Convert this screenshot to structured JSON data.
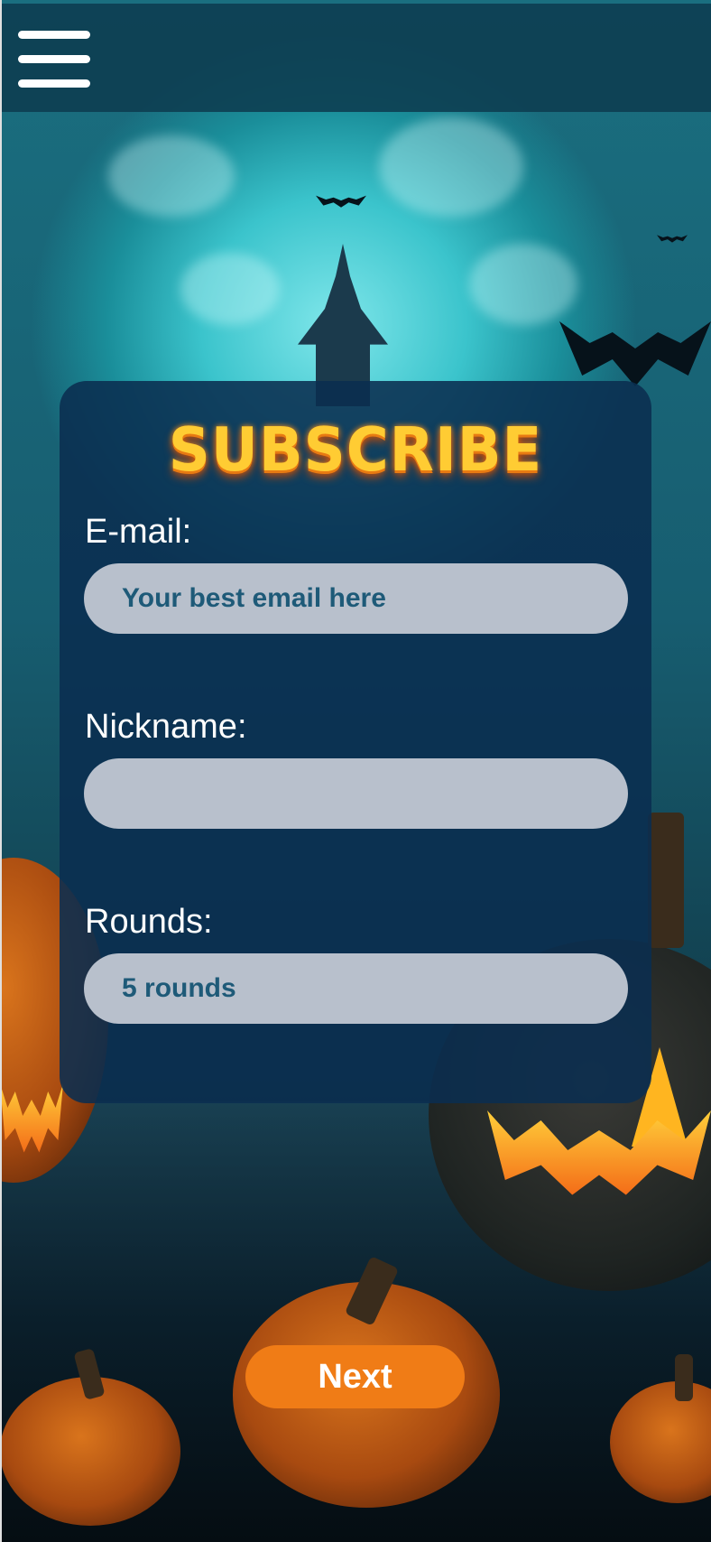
{
  "background": {
    "theme": "halloween-night",
    "accent_color": "#3bc4cc"
  },
  "topbar": {
    "menu_icon": "hamburger-menu-icon"
  },
  "form": {
    "title": "SUBSCRIBE",
    "title_color": "#ffcc33",
    "email": {
      "label": "E-mail:",
      "placeholder": "Your best email here",
      "value": ""
    },
    "nickname": {
      "label": "Nickname:",
      "placeholder": "",
      "value": ""
    },
    "rounds": {
      "label": "Rounds:",
      "selected": "5 rounds"
    }
  },
  "actions": {
    "next_label": "Next",
    "next_color": "#f07c16"
  }
}
